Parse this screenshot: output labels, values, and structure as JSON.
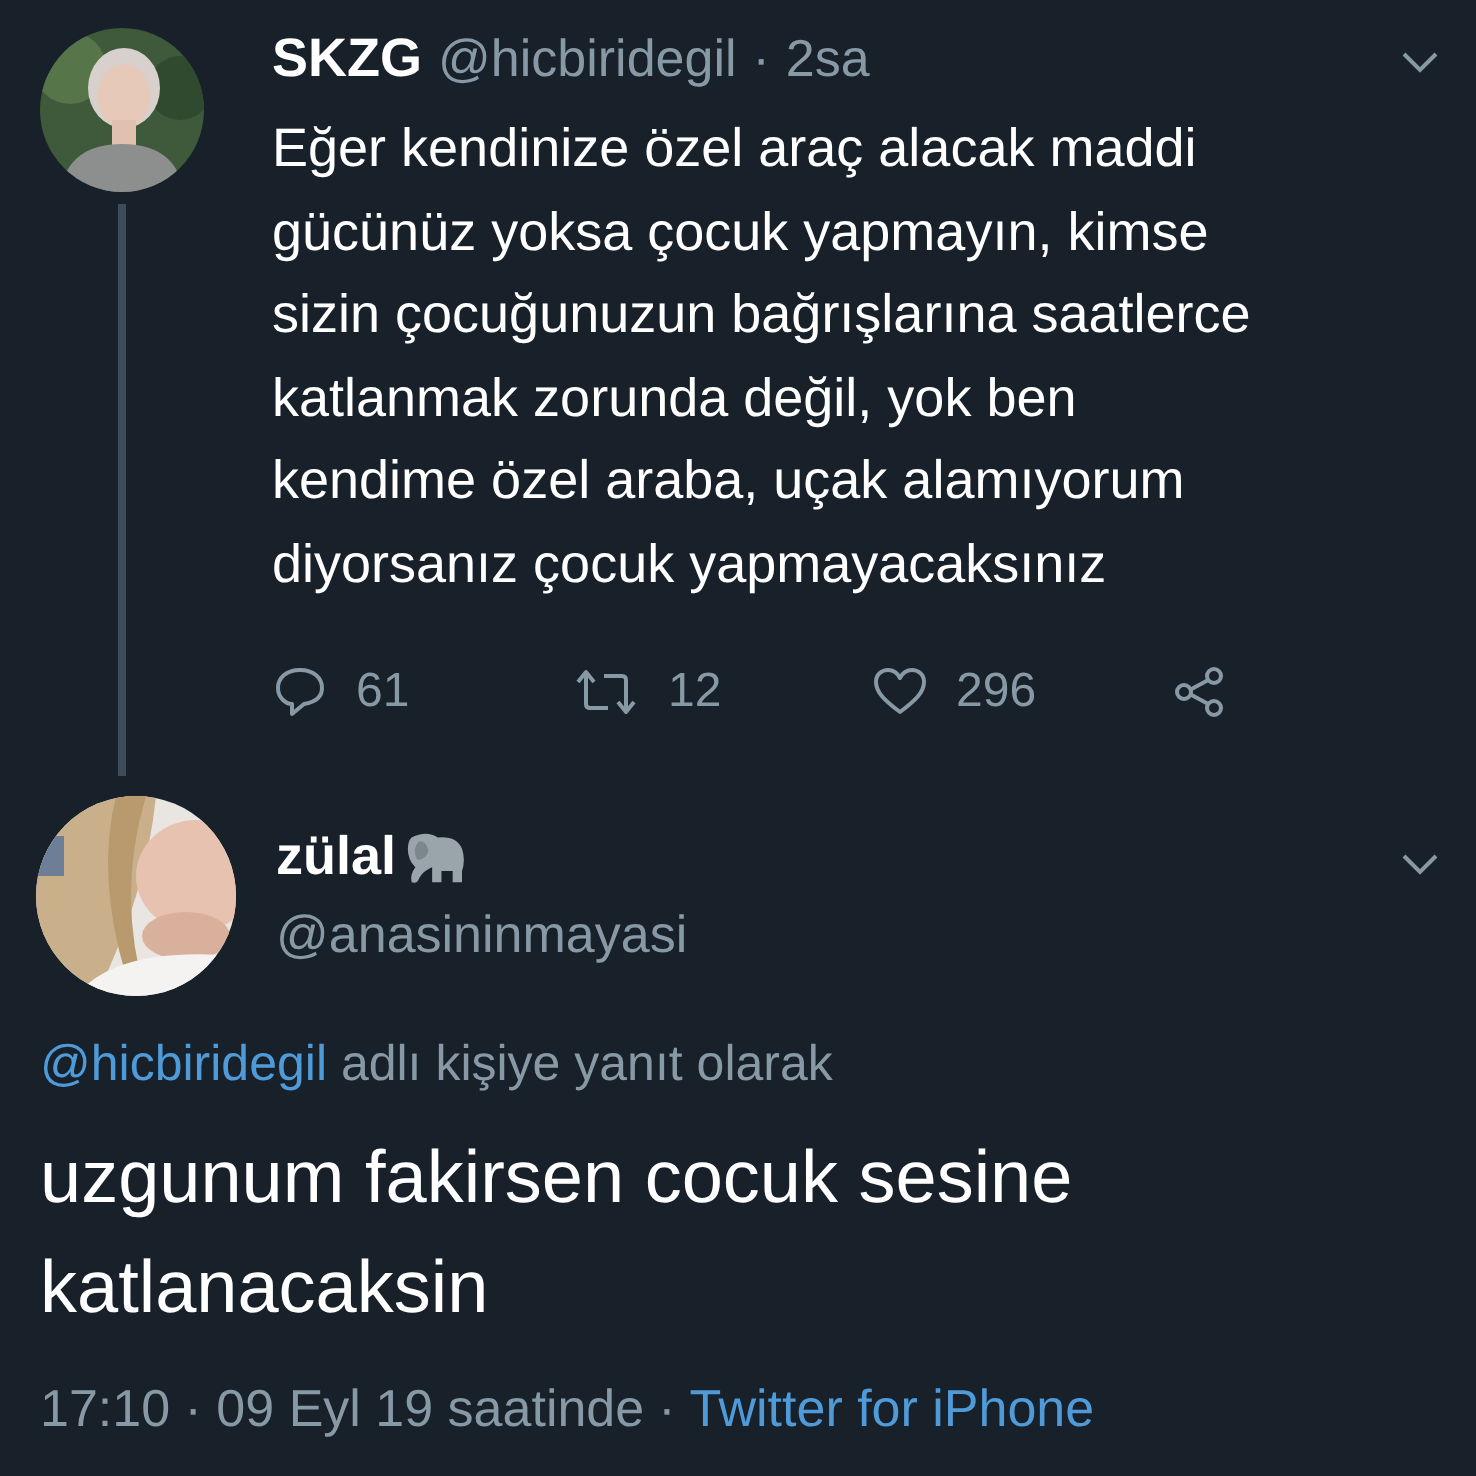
{
  "tweet": {
    "name": "SKZG",
    "handle": "@hicbiridegil",
    "separator": "·",
    "time": "2sa",
    "text": "Eğer kendinize özel araç alacak maddi\ngücünüz yoksa çocuk yapmayın, kimse\nsizin çocuğunuzun bağrışlarına saatlerce\nkatlanmak zorunda değil, yok ben\nkendime özel araba, uçak alamıyorum\ndiyorsanız çocuk yapmayacaksınız",
    "actions": [
      {
        "kind": "reply",
        "count": "61"
      },
      {
        "kind": "retweet",
        "count": "12"
      },
      {
        "kind": "like",
        "count": "296"
      },
      {
        "kind": "share"
      }
    ]
  },
  "reply": {
    "name": "zülal",
    "handle": "@anasininmayasi",
    "reply_to_link": "@hicbiridegil",
    "reply_to_text": "adlı kişiye yanıt olarak",
    "text": "uzgunum fakirsen cocuk sesine\nkatlanacaksin",
    "time": "17:10 · 09 Eyl 19 saatinde",
    "separator": "·",
    "source": "Twitter for iPhone"
  }
}
